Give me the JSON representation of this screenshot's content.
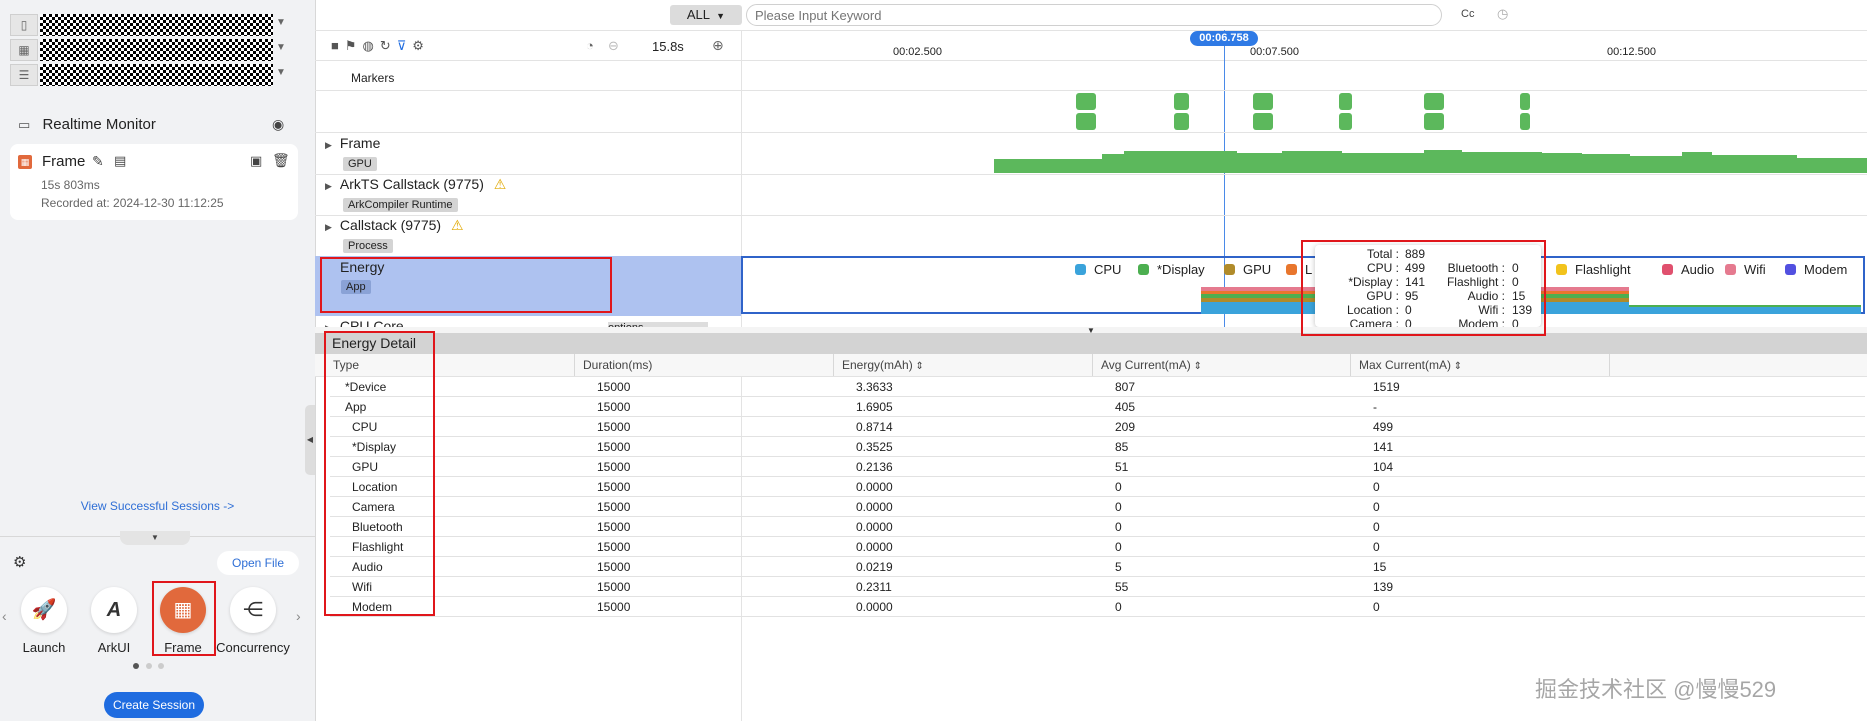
{
  "sidebar": {
    "realtime_monitor": "Realtime Monitor",
    "session": {
      "name": "Frame",
      "duration": "15s 803ms",
      "recorded_at": "Recorded at: 2024-12-30 11:12:25"
    },
    "view_sessions_link": "View Successful Sessions ->",
    "open_file": "Open File",
    "tools": [
      "Launch",
      "ArkUI",
      "Frame",
      "Concurrency"
    ],
    "create_session": "Create Session"
  },
  "toolbar": {
    "filter_all": "ALL",
    "search_placeholder": "Please Input Keyword",
    "case_label": "Cc",
    "duration": "15.8s"
  },
  "timeline": {
    "cursor_time": "00:06.758",
    "ticks": [
      "00:02.500",
      "00:07.500",
      "00:12.500"
    ]
  },
  "tracks": {
    "markers": "Markers",
    "frame": {
      "name": "Frame",
      "tag": "GPU"
    },
    "arkts": {
      "name": "ArkTS Callstack (9775)",
      "tag": "ArkCompiler Runtime"
    },
    "callstack": {
      "name": "Callstack (9775)",
      "tag": "Process"
    },
    "energy": {
      "name": "Energy",
      "tag": "App"
    },
    "cpu_core": {
      "name": "CPU Core",
      "options": "options"
    }
  },
  "energy_legend": [
    {
      "label": "CPU",
      "color": "#3aa3db"
    },
    {
      "label": "*Display",
      "color": "#4caf50"
    },
    {
      "label": "GPU",
      "color": "#b08b2a"
    },
    {
      "label": "L",
      "color": "#e8762d"
    },
    {
      "label": "Flashlight",
      "color": "#f2c31c"
    },
    {
      "label": "Audio",
      "color": "#e0506e"
    },
    {
      "label": "Wifi",
      "color": "#e57a8f"
    },
    {
      "label": "Modem",
      "color": "#5250e0"
    }
  ],
  "tooltip": {
    "total_label": "Total :",
    "total": "889",
    "left": [
      {
        "k": "CPU :",
        "v": "499"
      },
      {
        "k": "*Display :",
        "v": "141"
      },
      {
        "k": "GPU :",
        "v": "95"
      },
      {
        "k": "Location :",
        "v": "0"
      },
      {
        "k": "Camera :",
        "v": "0"
      }
    ],
    "right": [
      {
        "k": "Bluetooth :",
        "v": "0"
      },
      {
        "k": "Flashlight :",
        "v": "0"
      },
      {
        "k": "Audio :",
        "v": "15"
      },
      {
        "k": "Wifi :",
        "v": "139"
      },
      {
        "k": "Modem :",
        "v": "0"
      }
    ]
  },
  "detail": {
    "title": "Energy Detail",
    "columns": [
      "Type",
      "Duration(ms)",
      "Energy(mAh)",
      "Avg Current(mA)",
      "Max Current(mA)"
    ],
    "rows": [
      [
        "*Device",
        "15000",
        "3.3633",
        "807",
        "1519"
      ],
      [
        "App",
        "15000",
        "1.6905",
        "405",
        "-"
      ],
      [
        "CPU",
        "15000",
        "0.8714",
        "209",
        "499"
      ],
      [
        "*Display",
        "15000",
        "0.3525",
        "85",
        "141"
      ],
      [
        "GPU",
        "15000",
        "0.2136",
        "51",
        "104"
      ],
      [
        "Location",
        "15000",
        "0.0000",
        "0",
        "0"
      ],
      [
        "Camera",
        "15000",
        "0.0000",
        "0",
        "0"
      ],
      [
        "Bluetooth",
        "15000",
        "0.0000",
        "0",
        "0"
      ],
      [
        "Flashlight",
        "15000",
        "0.0000",
        "0",
        "0"
      ],
      [
        "Audio",
        "15000",
        "0.0219",
        "5",
        "15"
      ],
      [
        "Wifi",
        "15000",
        "0.2311",
        "55",
        "139"
      ],
      [
        "Modem",
        "15000",
        "0.0000",
        "0",
        "0"
      ]
    ]
  },
  "watermark": "掘金技术社区 @慢慢529"
}
